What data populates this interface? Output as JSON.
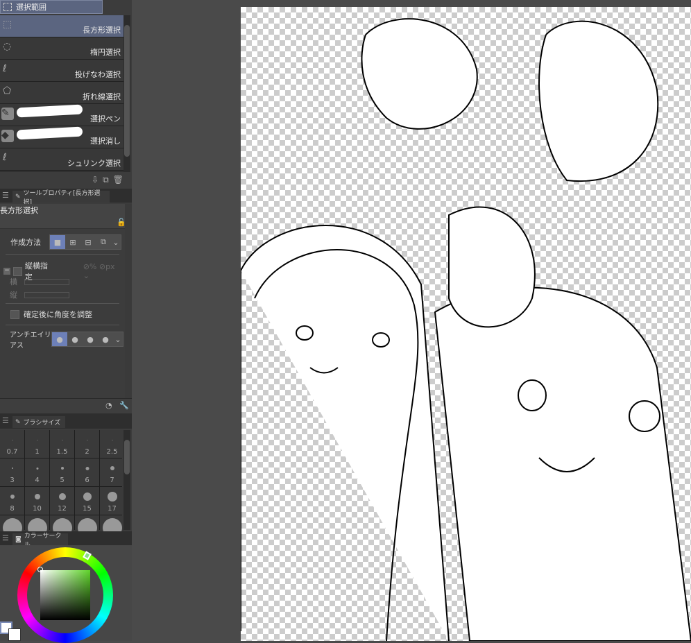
{
  "selection_panel": {
    "title": "選択範囲",
    "tools": [
      {
        "label": "長方形選択",
        "icon": "rect-select-icon",
        "selected": true
      },
      {
        "label": "楕円選択",
        "icon": "ellipse-select-icon"
      },
      {
        "label": "投げなわ選択",
        "icon": "lasso-select-icon"
      },
      {
        "label": "折れ線選択",
        "icon": "polyline-select-icon"
      },
      {
        "label": "選択ペン",
        "icon": "selection-pen-icon"
      },
      {
        "label": "選択消し",
        "icon": "selection-eraser-icon"
      },
      {
        "label": "シュリンク選択",
        "icon": "shrink-select-icon"
      }
    ]
  },
  "tool_property": {
    "tab": "ツールプロパティ[長方形選択]",
    "tool_name": "長方形選択",
    "creation_method": "作成方法",
    "aspect": "縦横指定",
    "width_label": "横",
    "height_label": "縦",
    "adjust_angle": "確定後に角度を調整",
    "antialias": "アンチエイリアス"
  },
  "brush_size": {
    "tab": "ブラシサイズ",
    "sizes": [
      "0.7",
      "1",
      "1.5",
      "2",
      "2.5",
      "3",
      "4",
      "5",
      "6",
      "7",
      "8",
      "10",
      "12",
      "15",
      "17"
    ]
  },
  "color_circle": {
    "tab": "カラーサークル",
    "hue_color": "#5fd42a"
  }
}
